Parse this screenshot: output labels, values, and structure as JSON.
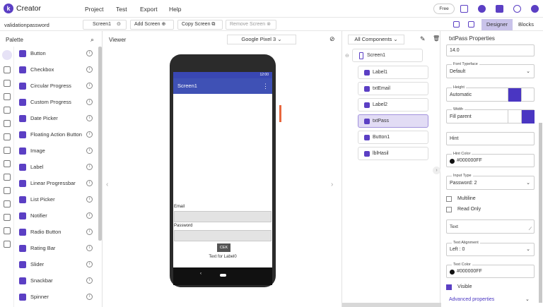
{
  "app": {
    "brand": "Creator",
    "logo_letter": "k"
  },
  "menu": [
    "Project",
    "Test",
    "Export",
    "Help"
  ],
  "plan": "Free",
  "project": {
    "name": "validationpassword",
    "screen": "Screen1"
  },
  "actions": {
    "add_screen": "Add Screen ⊕",
    "copy_screen": "Copy Screen ⧉",
    "remove_screen": "Remove Screen ⊗"
  },
  "modes": {
    "designer": "Designer",
    "blocks": "Blocks"
  },
  "palette": {
    "title": "Palette",
    "items": [
      "Button",
      "Checkbox",
      "Circular Progress",
      "Custom Progress",
      "Date Picker",
      "Floating Action Button",
      "Image",
      "Label",
      "Linear Progressbar",
      "List Picker",
      "Notifier",
      "Radio Button",
      "Rating Bar",
      "Slider",
      "Snackbar",
      "Spinner"
    ]
  },
  "viewer": {
    "title": "Viewer",
    "device": "Google Pixel 3  ⌄",
    "status_time": "12:00",
    "screen_title": "Screen1",
    "menu_dots": "⋮",
    "email_label": "Email",
    "password_label": "Password",
    "button_text": "CEK",
    "result_label": "Text for Label0"
  },
  "components": {
    "selector": "All Components  ⌄",
    "root": "Screen1",
    "items": [
      "Label1",
      "txtEmail",
      "Label2",
      "txtPass",
      "Button1",
      "lblHasil"
    ],
    "selected": "txtPass"
  },
  "properties": {
    "title": "txtPass Properties",
    "font_size": "14.0",
    "font_typeface": {
      "label": "Font Typeface",
      "value": "Default"
    },
    "height": {
      "label": "Height",
      "value": "Automatic"
    },
    "width": {
      "label": "Width",
      "value": "Fill parent"
    },
    "hint": "Hint",
    "hint_color": {
      "label": "Hint Color",
      "value": "#000000FF"
    },
    "input_type": {
      "label": "Input Type",
      "value": "Password: 2"
    },
    "multiline": "Multiline",
    "read_only": "Read Only",
    "text": "Text",
    "text_alignment": {
      "label": "Text Alignment",
      "value": "Left : 0"
    },
    "text_color": {
      "label": "Text Color",
      "value": "#000000FF"
    },
    "visible": "Visible",
    "advanced": "Advanced properties"
  },
  "colors": {
    "accent": "#5b3fc4",
    "appbar": "#3f51b5"
  }
}
